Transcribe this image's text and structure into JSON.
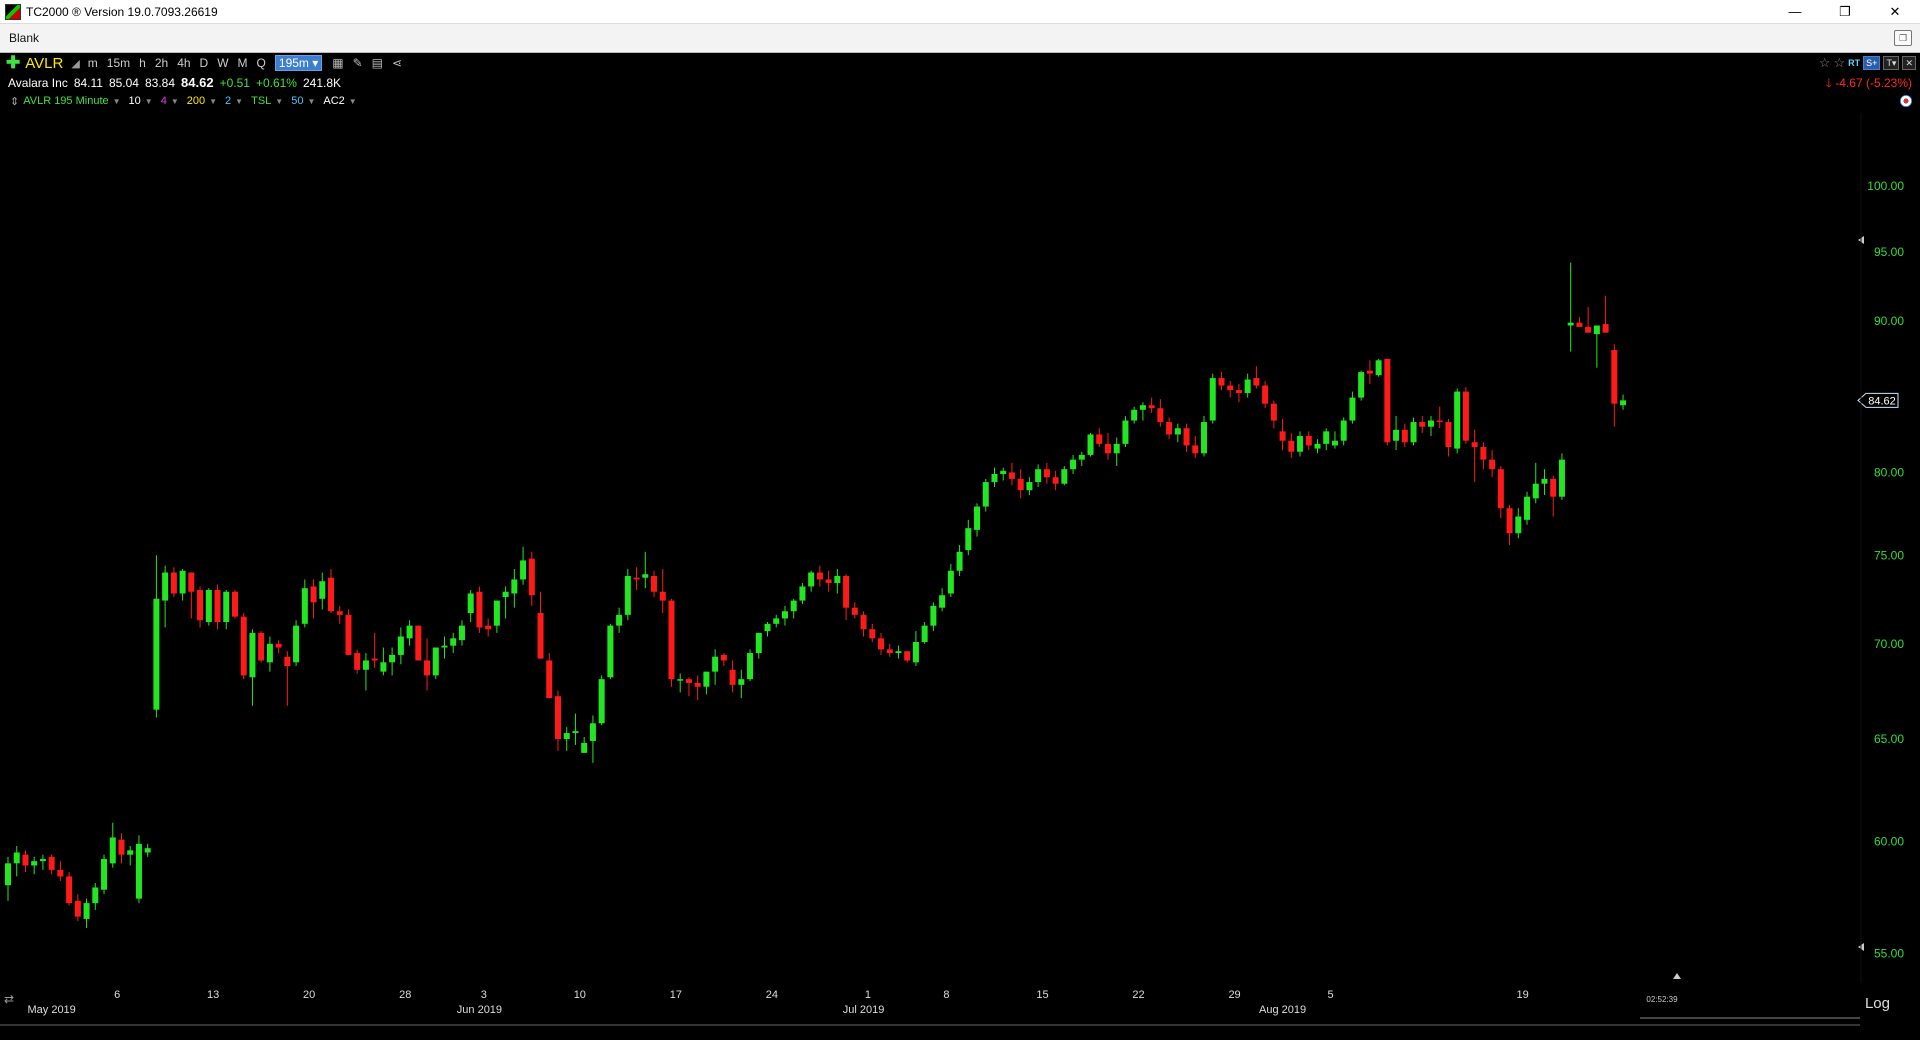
{
  "window": {
    "title": "TC2000 ® Version 19.0.7093.26619",
    "controls": [
      "—",
      "❐",
      "✕"
    ]
  },
  "tab": {
    "label": "Blank"
  },
  "toolbar": {
    "symbol": "AVLR",
    "timeframes": [
      "m",
      "15m",
      "h",
      "2h",
      "4h",
      "D",
      "W",
      "M",
      "Q"
    ],
    "selected_timeframe": "195m ▾",
    "rt_label": "RT"
  },
  "quote": {
    "name": "Avalara Inc",
    "open": "84.11",
    "high": "85.04",
    "low": "83.84",
    "last": "84.62",
    "change": "+0.51",
    "change_pct": "+0.61%",
    "volume": "241.8K",
    "right_change": "-4.67",
    "right_change_pct": "(-5.23%)"
  },
  "indicators": {
    "label": "AVLR 195 Minute",
    "ma1": "10",
    "ma2": "4",
    "ma3": "200",
    "ma4": "2",
    "tsl": "TSL",
    "tsl_val": "50",
    "ac": "AC2"
  },
  "colors": {
    "up": "#22e622",
    "down": "#ff1a1a",
    "axis_text": "#33dd33",
    "date_text": "#dddddd",
    "last_price_tag": "#c8e8ff"
  },
  "chart_data": {
    "type": "candlestick",
    "symbol": "AVLR",
    "interval": "195 Minute",
    "ylim": [
      54,
      103
    ],
    "y_ticks": [
      55,
      60,
      65,
      70,
      75,
      80,
      85,
      90,
      95,
      100
    ],
    "y_tick_labels": [
      "55.00",
      "60.00",
      "65.00",
      "70.00",
      "75.00",
      "80.00",
      "90.00",
      "95.00",
      "100.00"
    ],
    "y_tick_values": [
      55,
      60,
      65,
      70,
      75,
      80,
      90,
      95,
      100
    ],
    "last_price": 84.62,
    "last_price_label": "84.62",
    "x_day_labels": [
      {
        "label": "6",
        "bar": 12.5
      },
      {
        "label": "13",
        "bar": 23.5
      },
      {
        "label": "20",
        "bar": 34.5
      },
      {
        "label": "28",
        "bar": 45.5
      },
      {
        "label": "3",
        "bar": 54.5
      },
      {
        "label": "10",
        "bar": 65.5
      },
      {
        "label": "17",
        "bar": 76.5
      },
      {
        "label": "24",
        "bar": 87.5
      },
      {
        "label": "1",
        "bar": 98.5
      },
      {
        "label": "8",
        "bar": 107.5
      },
      {
        "label": "15",
        "bar": 118.5
      },
      {
        "label": "22",
        "bar": 129.5
      },
      {
        "label": "29",
        "bar": 140.5
      },
      {
        "label": "5",
        "bar": 151.5
      },
      {
        "label": "19",
        "bar": 173.5
      }
    ],
    "x_month_labels": [
      {
        "label": "May 2019",
        "bar": 5
      },
      {
        "label": "Jun 2019",
        "bar": 54
      },
      {
        "label": "Jul 2019",
        "bar": 98
      },
      {
        "label": "Aug 2019",
        "bar": 146
      }
    ],
    "time_label": "02:52:39",
    "scale_label": "Log",
    "candles": [
      [
        58,
        59.3,
        57.3,
        59
      ],
      [
        59,
        59.8,
        58.4,
        59.5
      ],
      [
        59.4,
        59.6,
        58.6,
        58.9
      ],
      [
        58.9,
        59.3,
        58.5,
        59.1
      ],
      [
        59.1,
        59.4,
        58.7,
        59.2
      ],
      [
        59.3,
        59.4,
        58.5,
        58.7
      ],
      [
        58.7,
        59.1,
        58.2,
        58.4
      ],
      [
        58.4,
        58.6,
        57.1,
        57.2
      ],
      [
        57.3,
        57.6,
        56.4,
        56.6
      ],
      [
        56.5,
        57.4,
        56.1,
        57.2
      ],
      [
        57.2,
        58.1,
        56.9,
        57.9
      ],
      [
        57.8,
        59.4,
        57.6,
        59.2
      ],
      [
        59,
        60.9,
        58.8,
        60.2
      ],
      [
        60.1,
        60.4,
        59,
        59.4
      ],
      [
        59.4,
        59.8,
        58.9,
        59.6
      ],
      [
        57.4,
        60.3,
        57.2,
        59.9
      ],
      [
        59.5,
        59.9,
        59.3,
        59.7
      ],
      [
        66.5,
        75,
        66.1,
        72.5
      ],
      [
        72.4,
        74.4,
        70.9,
        74
      ],
      [
        74,
        74.3,
        72.6,
        72.8
      ],
      [
        72.8,
        74.2,
        72.4,
        74.1
      ],
      [
        74,
        74,
        71.4,
        72.9
      ],
      [
        73,
        73.2,
        70.9,
        71.3
      ],
      [
        71.2,
        73.1,
        71,
        73
      ],
      [
        73,
        73.3,
        70.8,
        71.2
      ],
      [
        71.2,
        73,
        70.8,
        72.9
      ],
      [
        72.9,
        73,
        71.4,
        71.5
      ],
      [
        71.5,
        71.7,
        68.1,
        68.3
      ],
      [
        68.2,
        70.8,
        66.7,
        70.6
      ],
      [
        70.6,
        70.7,
        69,
        69.1
      ],
      [
        69,
        70.4,
        68.5,
        70
      ],
      [
        70,
        70.2,
        69.5,
        69.8
      ],
      [
        69.3,
        69.6,
        66.7,
        68.8
      ],
      [
        69,
        71.3,
        68.8,
        71
      ],
      [
        71.1,
        73.6,
        70.9,
        73.1
      ],
      [
        73.2,
        73.6,
        71.4,
        72.3
      ],
      [
        72.5,
        74,
        71.9,
        73.5
      ],
      [
        73.7,
        74.2,
        71.7,
        71.8
      ],
      [
        71.8,
        72.1,
        71.1,
        71.6
      ],
      [
        71.6,
        71.9,
        69.4,
        69.4
      ],
      [
        69.5,
        69.7,
        68.4,
        68.6
      ],
      [
        68.6,
        69.5,
        67.5,
        69.1
      ],
      [
        69.2,
        70.6,
        68.7,
        69.1
      ],
      [
        68.5,
        69.8,
        68.3,
        69
      ],
      [
        69,
        69.8,
        68.3,
        69.4
      ],
      [
        69.4,
        70.9,
        68.9,
        70.4
      ],
      [
        70.3,
        71.3,
        69.9,
        71
      ],
      [
        71,
        71,
        69.1,
        69.1
      ],
      [
        69.1,
        70.3,
        67.5,
        68.3
      ],
      [
        68.3,
        69.8,
        68.1,
        69.8
      ],
      [
        69.8,
        70.4,
        69.2,
        69.9
      ],
      [
        69.9,
        70.6,
        69.5,
        70.3
      ],
      [
        70.2,
        71.3,
        69.9,
        71
      ],
      [
        71.7,
        73,
        71.2,
        72.8
      ],
      [
        72.9,
        73.2,
        70.6,
        70.9
      ],
      [
        71,
        71.4,
        70.4,
        70.8
      ],
      [
        71,
        72.4,
        70.6,
        72.4
      ],
      [
        72.6,
        73.2,
        71.4,
        72.9
      ],
      [
        72.8,
        74.2,
        72,
        73.6
      ],
      [
        73.6,
        75.5,
        73.3,
        74.7
      ],
      [
        74.8,
        75.2,
        72.1,
        72.7
      ],
      [
        71.7,
        72.9,
        69.2,
        69.2
      ],
      [
        69.1,
        69.5,
        67.1,
        67.1
      ],
      [
        67.2,
        67.5,
        64.4,
        65
      ],
      [
        65,
        65.6,
        64.4,
        65.3
      ],
      [
        65.3,
        66.3,
        64.7,
        65.4
      ],
      [
        64.3,
        65.1,
        64.3,
        64.8
      ],
      [
        64.9,
        66.2,
        63.8,
        65.8
      ],
      [
        65.8,
        68.3,
        65.7,
        68.1
      ],
      [
        68.2,
        71.1,
        68.1,
        71
      ],
      [
        71,
        72,
        70.6,
        71.6
      ],
      [
        71.6,
        74.2,
        71.3,
        73.8
      ],
      [
        73.7,
        74.3,
        73,
        73.6
      ],
      [
        73.7,
        75.2,
        73.1,
        73.9
      ],
      [
        73.8,
        74.1,
        72.6,
        72.9
      ],
      [
        72.9,
        74.2,
        71.7,
        72.4
      ],
      [
        72.4,
        72.5,
        67.7,
        68.1
      ],
      [
        68.1,
        68.4,
        67.4,
        68.1
      ],
      [
        68.1,
        68.2,
        67.2,
        67.9
      ],
      [
        67.9,
        68.3,
        67,
        67.7
      ],
      [
        67.7,
        68.5,
        67.3,
        68.5
      ],
      [
        68.5,
        69.7,
        67.8,
        69.3
      ],
      [
        69.4,
        69.5,
        68.8,
        69.1
      ],
      [
        68.6,
        69.1,
        67.4,
        67.8
      ],
      [
        67.8,
        68.6,
        67.1,
        68.1
      ],
      [
        68.1,
        69.7,
        68,
        69.5
      ],
      [
        69.5,
        70.6,
        69.2,
        70.6
      ],
      [
        70.7,
        71.2,
        70.4,
        71.1
      ],
      [
        71.1,
        71.6,
        70.9,
        71.4
      ],
      [
        71.4,
        72.1,
        71,
        71.8
      ],
      [
        71.8,
        72.5,
        71.4,
        72.4
      ],
      [
        72.4,
        73.4,
        72.2,
        73.2
      ],
      [
        73.2,
        74.1,
        72.9,
        74
      ],
      [
        74,
        74.4,
        73.2,
        73.6
      ],
      [
        73.6,
        74.1,
        72.9,
        73.4
      ],
      [
        73.4,
        74.2,
        72.8,
        73.8
      ],
      [
        73.8,
        73.9,
        71.3,
        72
      ],
      [
        72,
        72.3,
        71.4,
        71.6
      ],
      [
        71.6,
        71.8,
        70.4,
        70.8
      ],
      [
        70.8,
        71.1,
        70.1,
        70.3
      ],
      [
        70.3,
        70.6,
        69.4,
        69.7
      ],
      [
        69.7,
        70,
        69.3,
        69.5
      ],
      [
        69.5,
        69.9,
        69.2,
        69.6
      ],
      [
        69.6,
        69.6,
        69,
        69.1
      ],
      [
        69,
        70.7,
        68.8,
        70.1
      ],
      [
        70.1,
        71.2,
        70,
        71
      ],
      [
        71,
        72.3,
        70.7,
        72.1
      ],
      [
        72,
        73.1,
        71.8,
        72.7
      ],
      [
        72.8,
        74.5,
        72.6,
        74.1
      ],
      [
        74.1,
        75.6,
        73.8,
        75.2
      ],
      [
        75.3,
        77.1,
        75,
        76.6
      ],
      [
        76.5,
        78.1,
        76.1,
        77.9
      ],
      [
        77.9,
        79.6,
        77.6,
        79.4
      ],
      [
        79.4,
        80.3,
        79.1,
        79.9
      ],
      [
        79.9,
        80.3,
        79.5,
        80.1
      ],
      [
        80,
        80.6,
        79.2,
        79.6
      ],
      [
        79.6,
        80.2,
        78.4,
        78.9
      ],
      [
        78.9,
        79.7,
        78.6,
        79.4
      ],
      [
        79.4,
        80.5,
        79.1,
        80.2
      ],
      [
        80.2,
        80.6,
        79.3,
        79.7
      ],
      [
        79.7,
        80.1,
        78.9,
        79.3
      ],
      [
        79.3,
        80.4,
        79.2,
        80.2
      ],
      [
        80.2,
        81.1,
        79.9,
        80.8
      ],
      [
        80.8,
        81.3,
        80.4,
        81.1
      ],
      [
        81.1,
        82.5,
        81,
        82.4
      ],
      [
        82.4,
        82.8,
        81.6,
        81.8
      ],
      [
        81.8,
        82.5,
        80.8,
        81.2
      ],
      [
        81.2,
        82.2,
        80.4,
        81.8
      ],
      [
        81.8,
        83.6,
        81.6,
        83.3
      ],
      [
        83.3,
        84.2,
        83.1,
        84
      ],
      [
        84,
        84.5,
        83.3,
        84.3
      ],
      [
        84.3,
        84.8,
        83.8,
        84.1
      ],
      [
        84.1,
        84.7,
        82.9,
        83.2
      ],
      [
        83.2,
        83.5,
        82.1,
        82.4
      ],
      [
        82.4,
        83.1,
        81.9,
        82.8
      ],
      [
        82.8,
        83.1,
        81.3,
        81.7
      ],
      [
        81.7,
        82.3,
        80.9,
        81.2
      ],
      [
        81.2,
        83.6,
        81,
        83.2
      ],
      [
        83.3,
        86.4,
        83.1,
        86.1
      ],
      [
        86.1,
        86.5,
        85.3,
        85.6
      ],
      [
        85.6,
        85.9,
        84.8,
        85.3
      ],
      [
        85.3,
        85.7,
        84.5,
        85.1
      ],
      [
        85.1,
        86.4,
        84.8,
        86
      ],
      [
        86.1,
        86.9,
        85.4,
        85.6
      ],
      [
        85.6,
        85.9,
        84.1,
        84.4
      ],
      [
        84.4,
        84.6,
        82.8,
        83.3
      ],
      [
        82.6,
        83.4,
        81.4,
        82
      ],
      [
        82,
        82.5,
        80.9,
        81.3
      ],
      [
        81.3,
        82.6,
        81,
        82.3
      ],
      [
        82.3,
        82.6,
        81.4,
        81.7
      ],
      [
        81.5,
        82.1,
        81.2,
        81.8
      ],
      [
        81.8,
        82.8,
        81.4,
        82.6
      ],
      [
        81.7,
        82.6,
        81.5,
        82
      ],
      [
        82,
        83.5,
        81.7,
        83.3
      ],
      [
        83.3,
        85.2,
        83.1,
        84.8
      ],
      [
        84.8,
        86.6,
        84.6,
        86.5
      ],
      [
        86.6,
        87.3,
        85.7,
        86.4
      ],
      [
        86.3,
        87.4,
        86.2,
        87.3
      ],
      [
        87.4,
        87.4,
        81.7,
        81.9
      ],
      [
        82,
        83.6,
        81.4,
        82.7
      ],
      [
        82.7,
        83.1,
        81.6,
        81.9
      ],
      [
        81.9,
        83.5,
        81.7,
        83.2
      ],
      [
        83.2,
        83.6,
        82.5,
        82.9
      ],
      [
        82.9,
        83.6,
        82.3,
        83.3
      ],
      [
        83.3,
        84.2,
        82.8,
        83.2
      ],
      [
        83.2,
        83.4,
        81,
        81.6
      ],
      [
        81.5,
        85.4,
        81.2,
        85.2
      ],
      [
        85.2,
        85.5,
        81.8,
        82
      ],
      [
        81.9,
        82.7,
        79.4,
        81.6
      ],
      [
        81.6,
        81.9,
        80.2,
        80.8
      ],
      [
        80.8,
        81.4,
        79.7,
        80.2
      ],
      [
        80.2,
        80.4,
        77.2,
        77.8
      ],
      [
        77.8,
        78,
        75.6,
        76.3
      ],
      [
        76.3,
        77.8,
        76,
        77.3
      ],
      [
        77.1,
        78.8,
        76.8,
        78.5
      ],
      [
        78.4,
        80.6,
        78.1,
        79.3
      ],
      [
        79.3,
        80.2,
        78.6,
        79.6
      ],
      [
        79.6,
        79.8,
        77.3,
        78.5
      ],
      [
        78.5,
        81.2,
        78.3,
        80.8
      ],
      [
        89.7,
        94.2,
        87.9,
        89.9
      ],
      [
        89.9,
        90.3,
        89.6,
        89.6
      ],
      [
        89.6,
        91,
        89.2,
        89.2
      ],
      [
        89.1,
        89.4,
        86.8,
        89.7
      ],
      [
        89.8,
        91.8,
        89.4,
        89.2
      ],
      [
        88,
        88.4,
        82.9,
        84.4
      ],
      [
        84.3,
        85,
        84,
        84.62
      ]
    ]
  }
}
